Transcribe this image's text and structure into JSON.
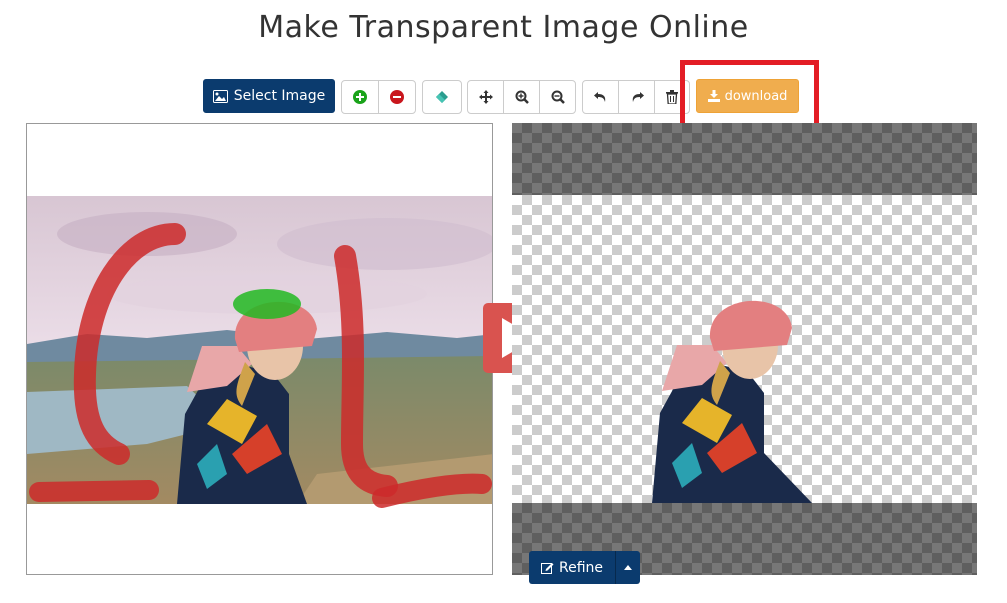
{
  "page": {
    "title": "Make Transparent Image Online"
  },
  "toolbar": {
    "select_image_label": "Select Image",
    "download_label": "download",
    "icons": [
      "image-icon",
      "add-icon",
      "remove-icon",
      "eraser-icon",
      "move-icon",
      "zoom-in-icon",
      "zoom-out-icon",
      "undo-icon",
      "redo-icon",
      "trash-icon",
      "download-icon"
    ]
  },
  "refine": {
    "label": "Refine"
  },
  "colors": {
    "primary": "#0b3b6e",
    "warning": "#f0ad4e",
    "play": "#d9534f",
    "highlight": "#e31d25",
    "keep_marker": "#22b822",
    "remove_marker": "#cc2a2a"
  }
}
